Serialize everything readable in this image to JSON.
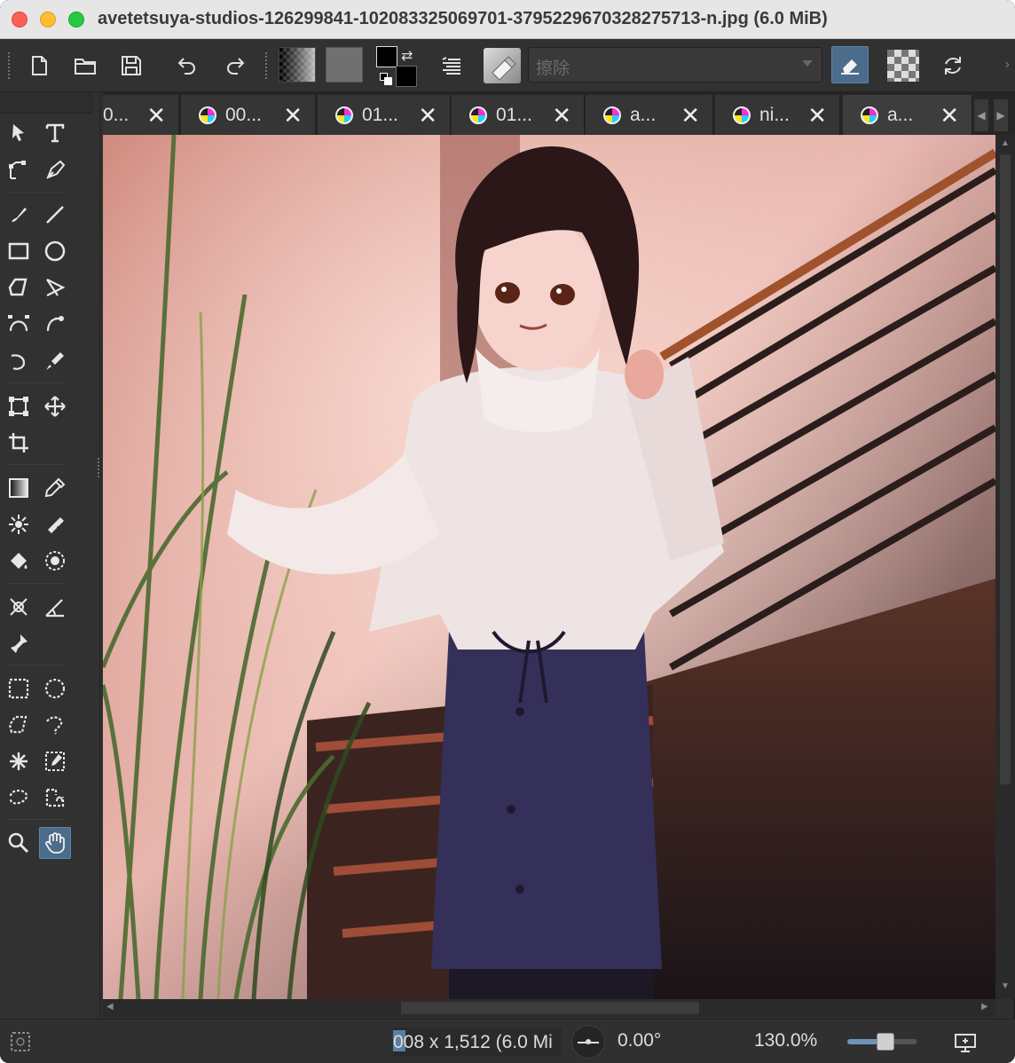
{
  "window": {
    "title": "avetetsuya-studios-126299841-1020833250697 01-3795229670328275713-n.jpg (6.0 MiB)"
  },
  "toolbar": {
    "brush_preset_name": "擦除",
    "buttons": [
      "new-document",
      "open-document",
      "save-document",
      "undo",
      "redo",
      "gradient-selector",
      "pattern-selector",
      "color-selector",
      "blending-mode",
      "brush-preset",
      "eraser-mode",
      "preserve-alpha",
      "reload-preset"
    ]
  },
  "tabs": [
    {
      "label": "0..."
    },
    {
      "label": "00..."
    },
    {
      "label": "01..."
    },
    {
      "label": "01..."
    },
    {
      "label": "a..."
    },
    {
      "label": "ni..."
    },
    {
      "label": "a..."
    }
  ],
  "tab_close_glyph": "✕",
  "toolbox": {
    "tools": [
      "select-shapes-icon",
      "text-icon",
      "edit-shapes-icon",
      "calligraphy-icon",
      "freehand-brush-icon",
      "line-icon",
      "rectangle-icon",
      "ellipse-icon",
      "polygon-icon",
      "polyline-icon",
      "bezier-curve-icon",
      "freehand-path-icon",
      "dynamic-brush-icon",
      "multibrush-icon",
      "transform-icon",
      "move-icon",
      "crop-icon",
      "gradient-icon",
      "color-sampler-icon",
      "colorize-mask-icon",
      "smart-patch-icon",
      "fill-icon",
      "enclose-fill-icon",
      "assistant-icon",
      "measure-icon",
      "reference-icon",
      "rect-select-icon",
      "ellipse-select-icon",
      "polygon-select-icon",
      "freehand-select-icon",
      "contiguous-select-icon",
      "similar-select-icon",
      "bezier-select-icon",
      "magnetic-select-icon",
      "zoom-icon",
      "pan-icon"
    ],
    "active_tool": "pan-icon"
  },
  "canvas": {
    "image_description_alt": "Illustration of a woman on a staircase"
  },
  "status": {
    "dimensions": "008 x 1,512 (6.0 Mi",
    "rotation": "0.00°",
    "zoom": "130.0%"
  }
}
